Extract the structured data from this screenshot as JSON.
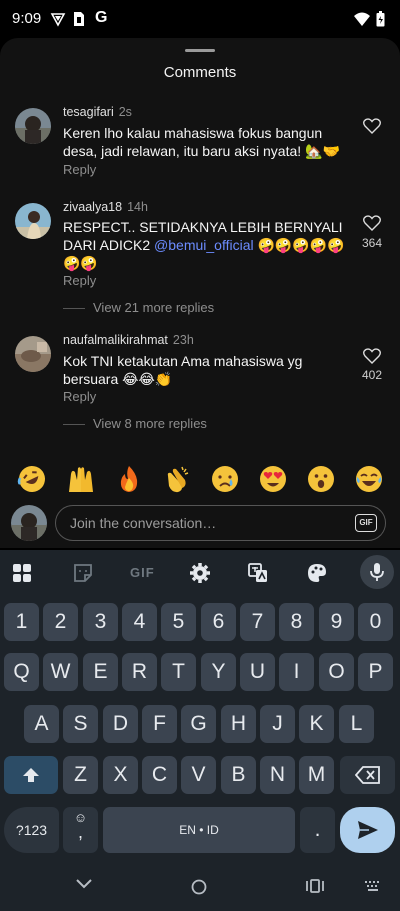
{
  "status": {
    "time": "9:09",
    "g_label": "G"
  },
  "sheet": {
    "title": "Comments"
  },
  "comments": [
    {
      "username": "tesagifari",
      "time": "2s",
      "text": "Keren lho kalau mahasiswa fokus bangun desa, jadi relawan, itu baru aksi nyata! 🏡🤝",
      "reply": "Reply",
      "likes": ""
    },
    {
      "username": "zivaalya18",
      "time": "14h",
      "text_before": "RESPECT.. SETIDAKNYA LEBIH BERNYALI DARI ADICK2 ",
      "mention": "@bemui_official",
      "text_after": " 🤪🤪🤪🤪🤪🤪🤪",
      "reply": "Reply",
      "likes": "364",
      "view_more": "View 21 more replies"
    },
    {
      "username": "naufalmalikirahmat",
      "time": "23h",
      "text": "Kok TNI ketakutan Ama mahasiswa yg bersuara 😂😂👏",
      "reply": "Reply",
      "likes": "402",
      "view_more": "View 8 more replies"
    }
  ],
  "emoji_bar": [
    "rofl",
    "raising-hands",
    "fire",
    "clap",
    "crying",
    "heart-eyes",
    "surprised",
    "joy"
  ],
  "composer": {
    "placeholder": "Join the conversation…",
    "gif": "GIF"
  },
  "keyboard": {
    "toolbar_gif": "GIF",
    "row_numbers": [
      "1",
      "2",
      "3",
      "4",
      "5",
      "6",
      "7",
      "8",
      "9",
      "0"
    ],
    "row1": [
      "Q",
      "W",
      "E",
      "R",
      "T",
      "Y",
      "U",
      "I",
      "O",
      "P"
    ],
    "row2": [
      "A",
      "S",
      "D",
      "F",
      "G",
      "H",
      "J",
      "K",
      "L"
    ],
    "row3": [
      "Z",
      "X",
      "C",
      "V",
      "B",
      "N",
      "M"
    ],
    "symbols_key": "?123",
    "emoji_key_top": "☺",
    "emoji_key_bottom": ",",
    "space_label": "EN • ID",
    "period": "."
  },
  "colors": {
    "sheet_bg": "#121212",
    "keyboard_bg": "#1d2329",
    "key_bg": "#3b4450",
    "mention": "#6c8cff",
    "enter": "#afd0ee"
  }
}
